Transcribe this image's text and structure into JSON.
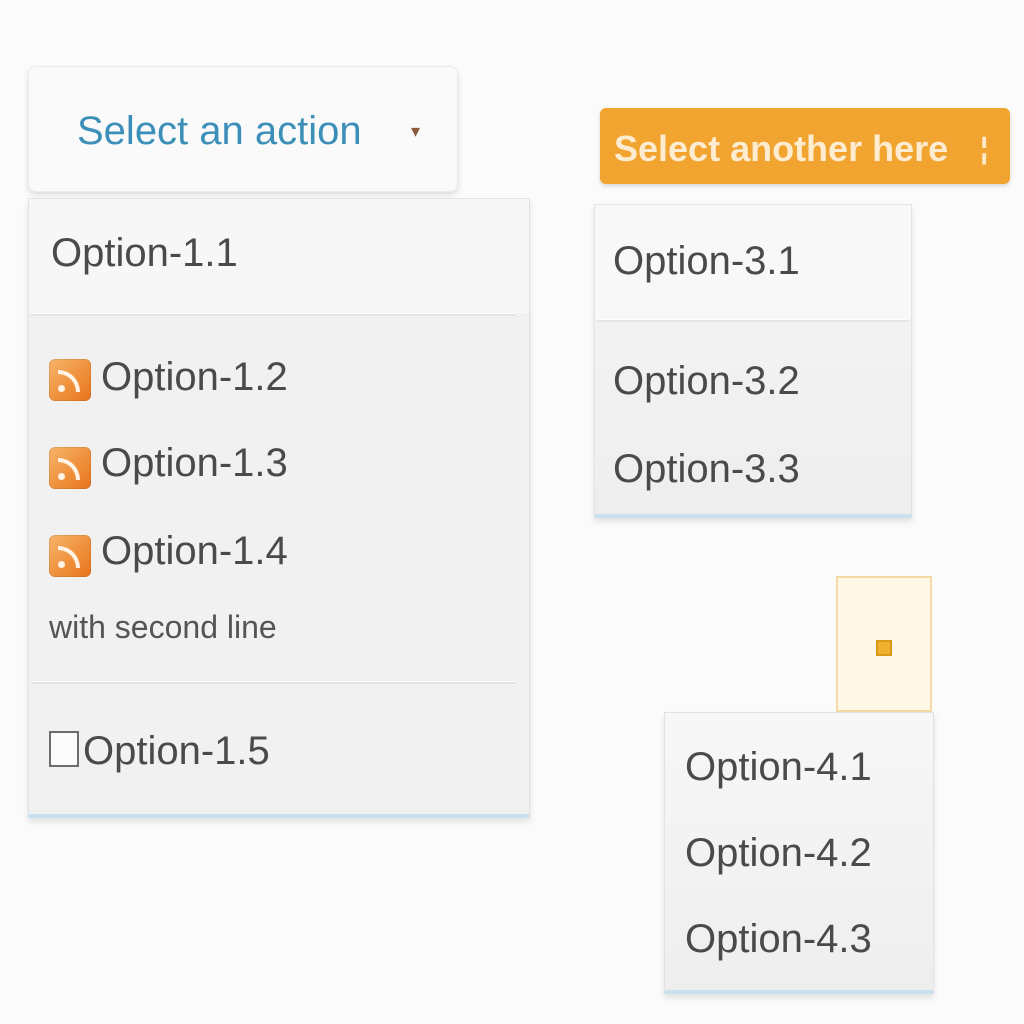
{
  "dropdown1": {
    "button_label": "Select an action",
    "caret": "▾",
    "items": [
      {
        "label": "Option-1.1"
      },
      {
        "label": "Option-1.2",
        "icon": "rss-icon"
      },
      {
        "label": "Option-1.3",
        "icon": "rss-icon"
      },
      {
        "label": "Option-1.4",
        "icon": "rss-icon",
        "sublabel": "with second line"
      },
      {
        "label": "Option-1.5",
        "icon": "checkbox"
      }
    ]
  },
  "dropdown3": {
    "button_label": "Select another here",
    "caret": "¦",
    "button_color": "#f2a431",
    "items": [
      {
        "label": "Option-3.1"
      },
      {
        "label": "Option-3.2"
      },
      {
        "label": "Option-3.3"
      }
    ]
  },
  "dropdown4": {
    "items": [
      {
        "label": "Option-4.1"
      },
      {
        "label": "Option-4.2"
      },
      {
        "label": "Option-4.3"
      }
    ]
  }
}
